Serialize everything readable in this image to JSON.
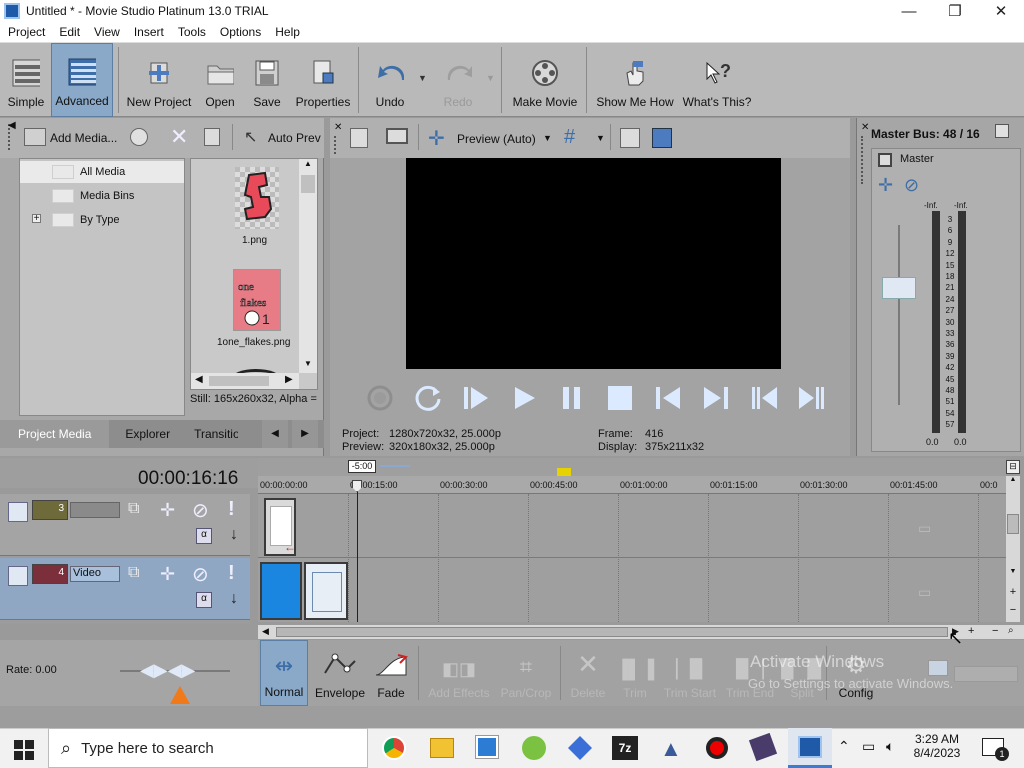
{
  "window": {
    "title": "Untitled * - Movie Studio Platinum 13.0 TRIAL",
    "minimize": "—",
    "maximize": "❐",
    "close": "✕"
  },
  "menu": [
    "Project",
    "Edit",
    "View",
    "Insert",
    "Tools",
    "Options",
    "Help"
  ],
  "toolbar": {
    "simple": "Simple",
    "advanced": "Advanced",
    "new_project": "New Project",
    "open": "Open",
    "save": "Save",
    "properties": "Properties",
    "undo": "Undo",
    "redo": "Redo",
    "make_movie": "Make Movie",
    "show_me_how": "Show Me How",
    "whats_this": "What's This?"
  },
  "media": {
    "add_media": "Add Media...",
    "auto_preview": "Auto Prev",
    "tree": [
      "All Media",
      "Media Bins",
      "By Type"
    ],
    "files": [
      "1.png",
      "1one_flakes.png"
    ],
    "still_info": "Still: 165x260x32, Alpha =",
    "tabs": [
      "Project Media",
      "Explorer",
      "Transitio"
    ]
  },
  "preview": {
    "mode": "Preview (Auto)",
    "project_label": "Project:",
    "project_value": "1280x720x32, 25.000p",
    "preview_label": "Preview:",
    "preview_value": "320x180x32, 25.000p",
    "frame_label": "Frame:",
    "frame_value": "416",
    "display_label": "Display:",
    "display_value": "375x211x32"
  },
  "master": {
    "title": "Master Bus:",
    "value": "48 / 16",
    "label": "Master",
    "inf_left": "-Inf.",
    "inf_right": "-Inf.",
    "scale": [
      "3",
      "6",
      "9",
      "12",
      "15",
      "18",
      "21",
      "24",
      "27",
      "30",
      "33",
      "36",
      "39",
      "42",
      "45",
      "48",
      "51",
      "54",
      "57"
    ],
    "bottom_left": "0.0",
    "bottom_right": "0.0"
  },
  "timeline": {
    "time": "00:00:16:16",
    "offset": "-5:00",
    "ticks": [
      "00:00:00:00",
      "00:00:15:00",
      "00:00:30:00",
      "00:00:45:00",
      "00:01:00:00",
      "00:01:15:00",
      "00:01:30:00",
      "00:01:45:00",
      "00:0"
    ],
    "tracks": [
      {
        "number": "3",
        "name": ""
      },
      {
        "number": "4",
        "name": "Video"
      }
    ],
    "rate": "Rate: 0.00"
  },
  "edit_tools": {
    "normal": "Normal",
    "envelope": "Envelope",
    "fade": "Fade",
    "add_effects": "Add Effects",
    "pan_crop": "Pan/Crop",
    "delete": "Delete",
    "trim": "Trim",
    "trim_start": "Trim Start",
    "trim_end": "Trim End",
    "split": "Split",
    "config": "Config"
  },
  "watermark": {
    "line1": "Activate Windows",
    "line2": "Go to Settings to activate Windows."
  },
  "taskbar": {
    "search_placeholder": "Type here to search",
    "time": "3:29 AM",
    "date": "8/4/2023",
    "notification_count": "1"
  }
}
